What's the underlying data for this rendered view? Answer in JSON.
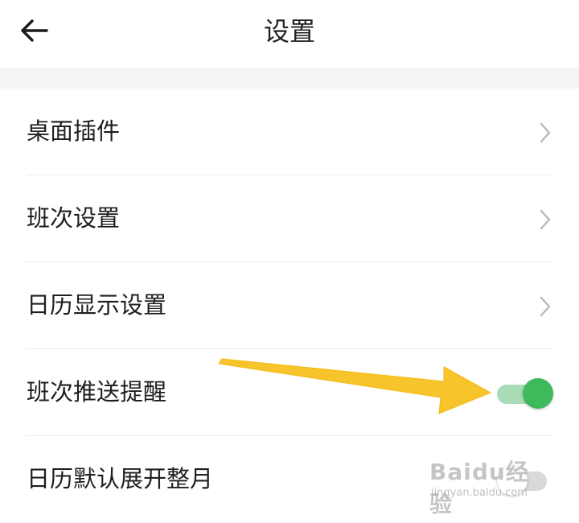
{
  "header": {
    "back_icon": "arrow-left-icon",
    "title": "设置"
  },
  "settings": {
    "items": [
      {
        "label": "桌面插件",
        "control": "chevron",
        "icon": "chevron-right-icon"
      },
      {
        "label": "班次设置",
        "control": "chevron",
        "icon": "chevron-right-icon"
      },
      {
        "label": "日历显示设置",
        "control": "chevron",
        "icon": "chevron-right-icon"
      },
      {
        "label": "班次推送提醒",
        "control": "toggle",
        "toggle_on": true
      },
      {
        "label": "日历默认展开整月",
        "control": "toggle",
        "toggle_on": false
      }
    ]
  },
  "annotation": {
    "icon": "yellow-arrow-icon",
    "color": "#f7c52b"
  },
  "watermark": {
    "brand": "Baidu经验",
    "site": "jingyan.baidu.com"
  },
  "colors": {
    "toggle_on_knob": "#3dba5c",
    "toggle_on_track": "#a8dcb6",
    "divider": "#ececec",
    "section_gap": "#f4f4f4"
  }
}
